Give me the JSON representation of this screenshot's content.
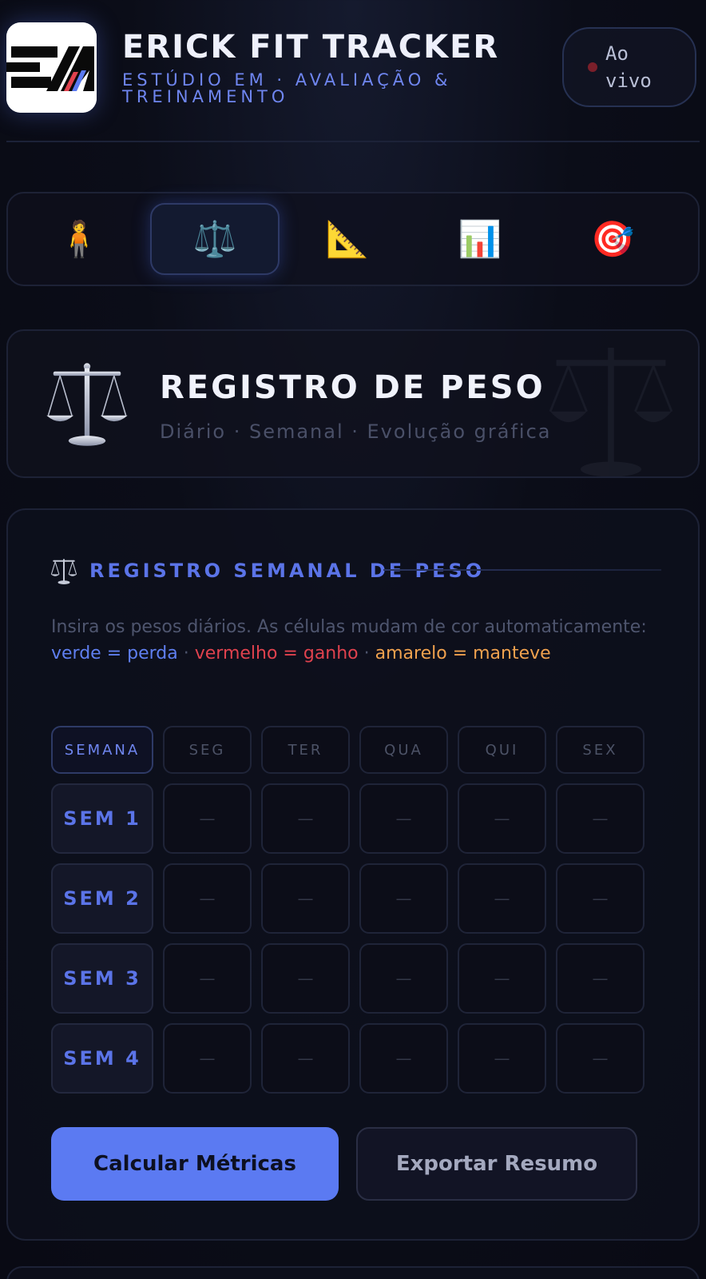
{
  "header": {
    "title": "ERICK FIT TRACKER",
    "subtitle": "Estúdio EM · Avaliação & Treinamento",
    "live_label": "Ao vivo",
    "logo_text": "EM"
  },
  "nav": {
    "tabs": [
      {
        "icon": "🧍",
        "name": "person-standing-icon",
        "active": false
      },
      {
        "icon": "⚖️",
        "name": "balance-scale-icon",
        "active": true
      },
      {
        "icon": "📐",
        "name": "triangle-ruler-icon",
        "active": false
      },
      {
        "icon": "📊",
        "name": "bar-chart-icon",
        "active": false
      },
      {
        "icon": "🎯",
        "name": "target-icon",
        "active": false
      }
    ]
  },
  "hero": {
    "title": "REGISTRO DE PESO",
    "subtitle": "Diário · Semanal · Evolução gráfica"
  },
  "card": {
    "title": "REGISTRO SEMANAL DE PESO",
    "instructions_prefix": "Insira os pesos diários. As células mudam de cor automaticamente: ",
    "legend_green": "verde = perda",
    "legend_sep": " · ",
    "legend_red": "vermelho = ganho",
    "legend_yellow": "amarelo = manteve",
    "columns": [
      "SEMANA",
      "SEG",
      "TER",
      "QUA",
      "QUI",
      "SEX"
    ],
    "rows": [
      {
        "label": "SEM 1",
        "values": [
          "—",
          "—",
          "—",
          "—",
          "—"
        ]
      },
      {
        "label": "SEM 2",
        "values": [
          "—",
          "—",
          "—",
          "—",
          "—"
        ]
      },
      {
        "label": "SEM 3",
        "values": [
          "—",
          "—",
          "—",
          "—",
          "—"
        ]
      },
      {
        "label": "SEM 4",
        "values": [
          "—",
          "—",
          "—",
          "—",
          "—"
        ]
      }
    ],
    "primary_button": "Calcular Métricas",
    "secondary_button": "Exportar Resumo"
  },
  "colors": {
    "accent": "#5b7af2",
    "loss": "#5f7ff0",
    "gain": "#e0424e",
    "kept": "#f0a14e"
  }
}
